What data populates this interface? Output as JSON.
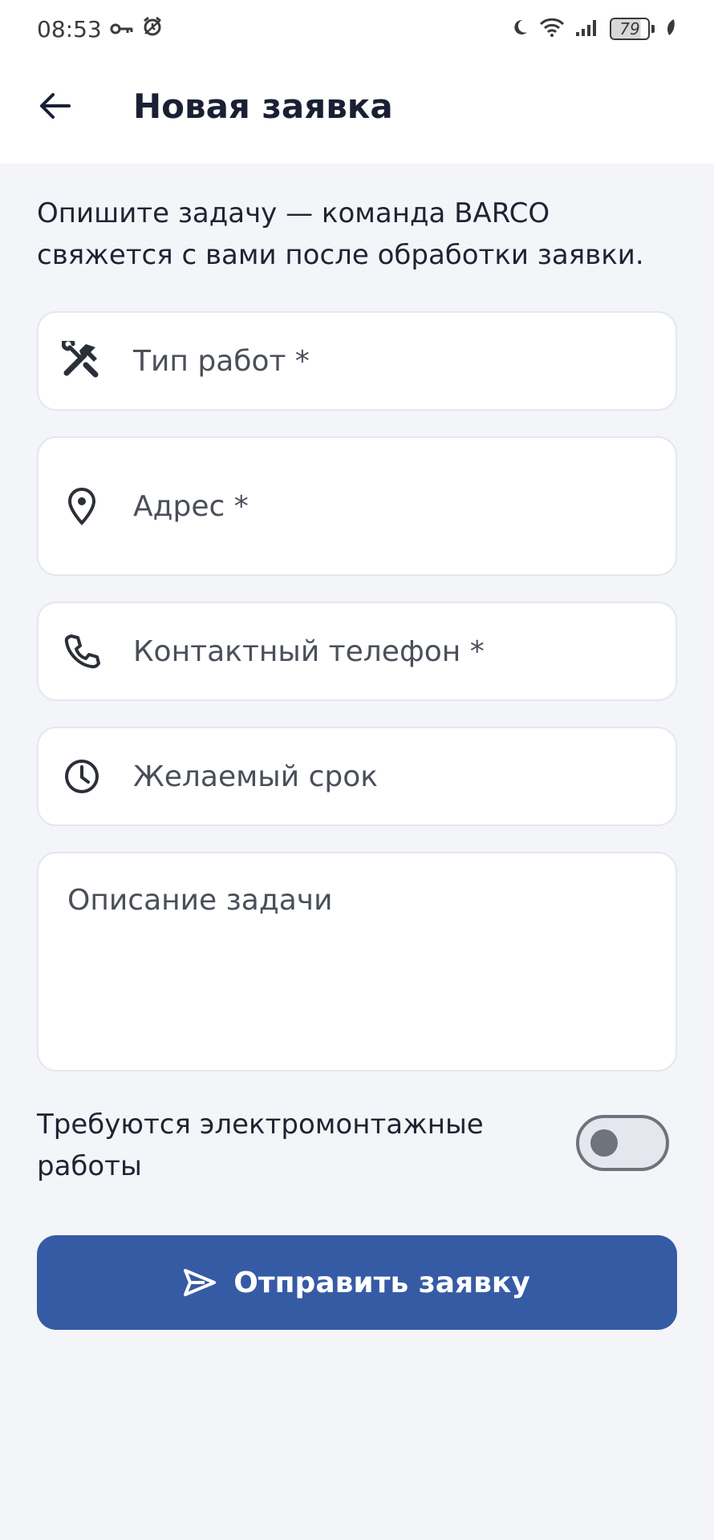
{
  "status_bar": {
    "time": "08:53",
    "battery": "79",
    "icons": [
      "key-icon",
      "alarm-icon",
      "moon-icon",
      "wifi-icon",
      "signal-icon",
      "battery-icon",
      "leaf-icon"
    ]
  },
  "header": {
    "title": "Новая заявка",
    "back_icon": "arrow-left-icon"
  },
  "intro": "Опишите задачу — команда BARCO свяжется с вами после обработки заявки.",
  "form": {
    "work_type": {
      "label": "Тип работ *",
      "icon": "tools-icon"
    },
    "address": {
      "label": "Адрес *",
      "icon": "location-pin-icon"
    },
    "phone": {
      "label": "Контактный телефон *",
      "icon": "phone-icon"
    },
    "deadline": {
      "label": "Желаемый срок",
      "icon": "clock-icon"
    },
    "description": {
      "label": "Описание задачи"
    },
    "electrical": {
      "label": "Требуются электромонтажные работы",
      "enabled": false
    }
  },
  "submit": {
    "label": "Отправить заявку",
    "icon": "send-icon",
    "color": "#365ba5"
  }
}
